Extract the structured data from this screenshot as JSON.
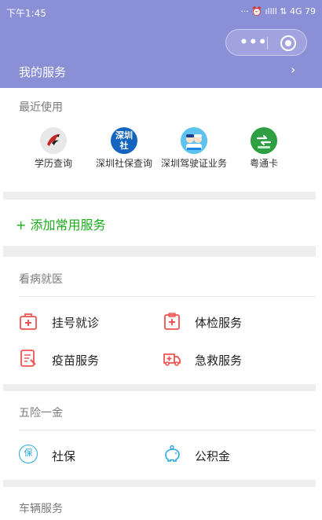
{
  "status_bar": {
    "time": "下午1:45",
    "right": "··· ⏰ ıllll ⇅ 4G 79"
  },
  "header": {
    "title": "我的服务",
    "arrow": "›"
  },
  "recent": {
    "title": "最近使用",
    "items": [
      {
        "label": "学历查询"
      },
      {
        "label": "深圳社保查询",
        "icon_text": "深圳社"
      },
      {
        "label": "深圳驾驶证业务"
      },
      {
        "label": "粤通卡"
      }
    ]
  },
  "add_service": "+ 添加常用服务",
  "medical": {
    "title": "看病就医",
    "items": [
      {
        "label": "挂号就诊"
      },
      {
        "label": "体检服务"
      },
      {
        "label": "疫苗服务"
      },
      {
        "label": "急救服务"
      }
    ]
  },
  "insurance": {
    "title": "五险一金",
    "items": [
      {
        "label": "社保",
        "icon_text": "保"
      },
      {
        "label": "公积金"
      }
    ]
  },
  "vehicle": {
    "title": "车辆服务"
  },
  "colors": {
    "header_bg": "#8b8fd6",
    "accent_green": "#1aad19",
    "icon_red": "#ef5350",
    "icon_blue": "#29a8e0"
  }
}
